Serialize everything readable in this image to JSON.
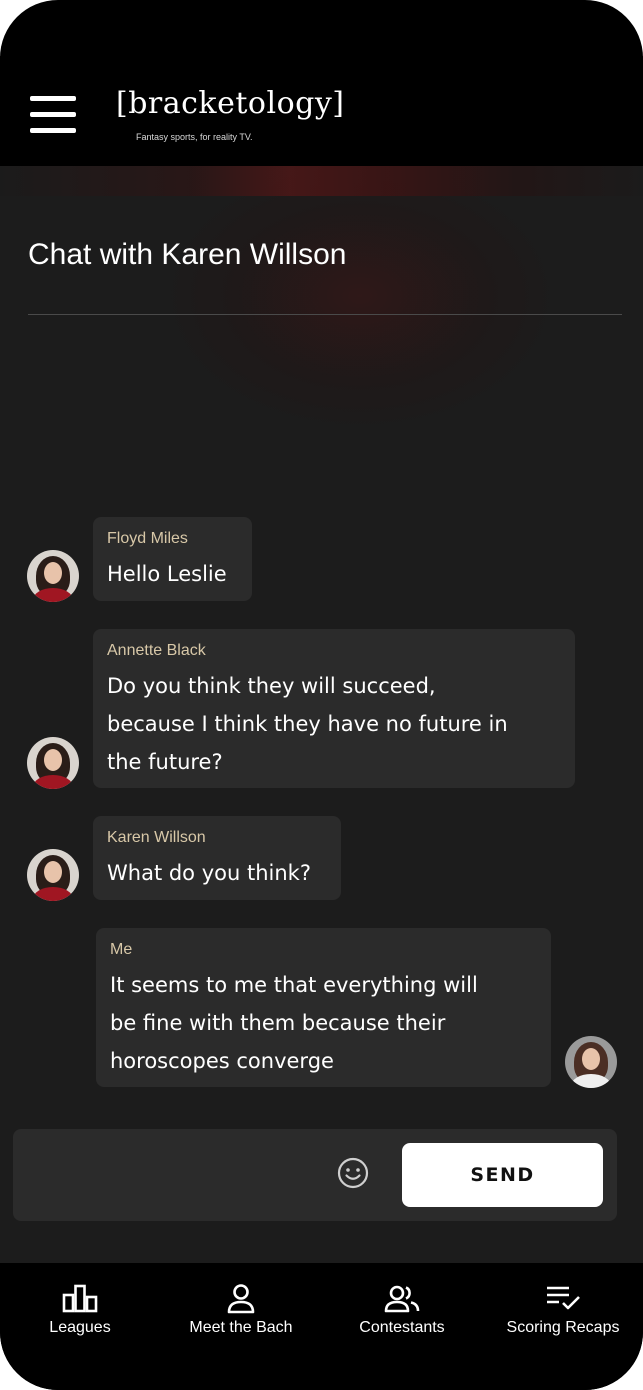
{
  "app": {
    "logo_text": "[bracketology]",
    "logo_tagline": "Fantasy sports, for reality TV."
  },
  "chat": {
    "title": "Chat with Karen Willson",
    "messages": [
      {
        "sender": "Floyd Miles",
        "lines": [
          "Hello Leslie"
        ]
      },
      {
        "sender": "Annette Black",
        "lines": [
          "Do you think they will succeed,",
          "because I think they have no future in",
          "the future?"
        ]
      },
      {
        "sender": "Karen Willson",
        "lines": [
          "What do you think?"
        ]
      },
      {
        "sender": "Me",
        "lines": [
          "It seems to me that everything will",
          "be fine with them because their",
          "horoscopes converge"
        ]
      }
    ]
  },
  "composer": {
    "input_value": "",
    "emoji_icon": "smiley-icon",
    "send_label": "SEND"
  },
  "bottom_nav": {
    "items": [
      {
        "label": "Leagues",
        "icon": "bar-chart-icon"
      },
      {
        "label": "Meet the Bach",
        "icon": "person-icon"
      },
      {
        "label": "Contestants",
        "icon": "people-icon"
      },
      {
        "label": "Scoring Recaps",
        "icon": "checklist-icon"
      }
    ]
  },
  "colors": {
    "background": "#1c1c1c",
    "bubble": "#2b2b2b",
    "sender_name": "#d8c8a8",
    "accent_red": "#a01622"
  }
}
